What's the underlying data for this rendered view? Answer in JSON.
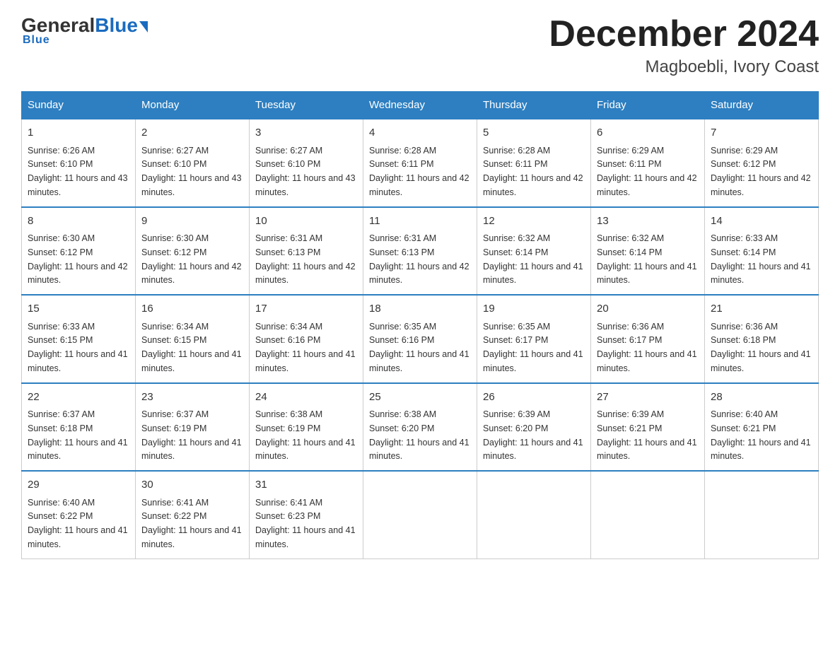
{
  "header": {
    "logo_general": "General",
    "logo_blue": "Blue",
    "title": "December 2024",
    "subtitle": "Magboebli, Ivory Coast"
  },
  "columns": [
    "Sunday",
    "Monday",
    "Tuesday",
    "Wednesday",
    "Thursday",
    "Friday",
    "Saturday"
  ],
  "weeks": [
    [
      {
        "day": "1",
        "sunrise": "6:26 AM",
        "sunset": "6:10 PM",
        "daylight": "11 hours and 43 minutes."
      },
      {
        "day": "2",
        "sunrise": "6:27 AM",
        "sunset": "6:10 PM",
        "daylight": "11 hours and 43 minutes."
      },
      {
        "day": "3",
        "sunrise": "6:27 AM",
        "sunset": "6:10 PM",
        "daylight": "11 hours and 43 minutes."
      },
      {
        "day": "4",
        "sunrise": "6:28 AM",
        "sunset": "6:11 PM",
        "daylight": "11 hours and 42 minutes."
      },
      {
        "day": "5",
        "sunrise": "6:28 AM",
        "sunset": "6:11 PM",
        "daylight": "11 hours and 42 minutes."
      },
      {
        "day": "6",
        "sunrise": "6:29 AM",
        "sunset": "6:11 PM",
        "daylight": "11 hours and 42 minutes."
      },
      {
        "day": "7",
        "sunrise": "6:29 AM",
        "sunset": "6:12 PM",
        "daylight": "11 hours and 42 minutes."
      }
    ],
    [
      {
        "day": "8",
        "sunrise": "6:30 AM",
        "sunset": "6:12 PM",
        "daylight": "11 hours and 42 minutes."
      },
      {
        "day": "9",
        "sunrise": "6:30 AM",
        "sunset": "6:12 PM",
        "daylight": "11 hours and 42 minutes."
      },
      {
        "day": "10",
        "sunrise": "6:31 AM",
        "sunset": "6:13 PM",
        "daylight": "11 hours and 42 minutes."
      },
      {
        "day": "11",
        "sunrise": "6:31 AM",
        "sunset": "6:13 PM",
        "daylight": "11 hours and 42 minutes."
      },
      {
        "day": "12",
        "sunrise": "6:32 AM",
        "sunset": "6:14 PM",
        "daylight": "11 hours and 41 minutes."
      },
      {
        "day": "13",
        "sunrise": "6:32 AM",
        "sunset": "6:14 PM",
        "daylight": "11 hours and 41 minutes."
      },
      {
        "day": "14",
        "sunrise": "6:33 AM",
        "sunset": "6:14 PM",
        "daylight": "11 hours and 41 minutes."
      }
    ],
    [
      {
        "day": "15",
        "sunrise": "6:33 AM",
        "sunset": "6:15 PM",
        "daylight": "11 hours and 41 minutes."
      },
      {
        "day": "16",
        "sunrise": "6:34 AM",
        "sunset": "6:15 PM",
        "daylight": "11 hours and 41 minutes."
      },
      {
        "day": "17",
        "sunrise": "6:34 AM",
        "sunset": "6:16 PM",
        "daylight": "11 hours and 41 minutes."
      },
      {
        "day": "18",
        "sunrise": "6:35 AM",
        "sunset": "6:16 PM",
        "daylight": "11 hours and 41 minutes."
      },
      {
        "day": "19",
        "sunrise": "6:35 AM",
        "sunset": "6:17 PM",
        "daylight": "11 hours and 41 minutes."
      },
      {
        "day": "20",
        "sunrise": "6:36 AM",
        "sunset": "6:17 PM",
        "daylight": "11 hours and 41 minutes."
      },
      {
        "day": "21",
        "sunrise": "6:36 AM",
        "sunset": "6:18 PM",
        "daylight": "11 hours and 41 minutes."
      }
    ],
    [
      {
        "day": "22",
        "sunrise": "6:37 AM",
        "sunset": "6:18 PM",
        "daylight": "11 hours and 41 minutes."
      },
      {
        "day": "23",
        "sunrise": "6:37 AM",
        "sunset": "6:19 PM",
        "daylight": "11 hours and 41 minutes."
      },
      {
        "day": "24",
        "sunrise": "6:38 AM",
        "sunset": "6:19 PM",
        "daylight": "11 hours and 41 minutes."
      },
      {
        "day": "25",
        "sunrise": "6:38 AM",
        "sunset": "6:20 PM",
        "daylight": "11 hours and 41 minutes."
      },
      {
        "day": "26",
        "sunrise": "6:39 AM",
        "sunset": "6:20 PM",
        "daylight": "11 hours and 41 minutes."
      },
      {
        "day": "27",
        "sunrise": "6:39 AM",
        "sunset": "6:21 PM",
        "daylight": "11 hours and 41 minutes."
      },
      {
        "day": "28",
        "sunrise": "6:40 AM",
        "sunset": "6:21 PM",
        "daylight": "11 hours and 41 minutes."
      }
    ],
    [
      {
        "day": "29",
        "sunrise": "6:40 AM",
        "sunset": "6:22 PM",
        "daylight": "11 hours and 41 minutes."
      },
      {
        "day": "30",
        "sunrise": "6:41 AM",
        "sunset": "6:22 PM",
        "daylight": "11 hours and 41 minutes."
      },
      {
        "day": "31",
        "sunrise": "6:41 AM",
        "sunset": "6:23 PM",
        "daylight": "11 hours and 41 minutes."
      },
      null,
      null,
      null,
      null
    ]
  ]
}
